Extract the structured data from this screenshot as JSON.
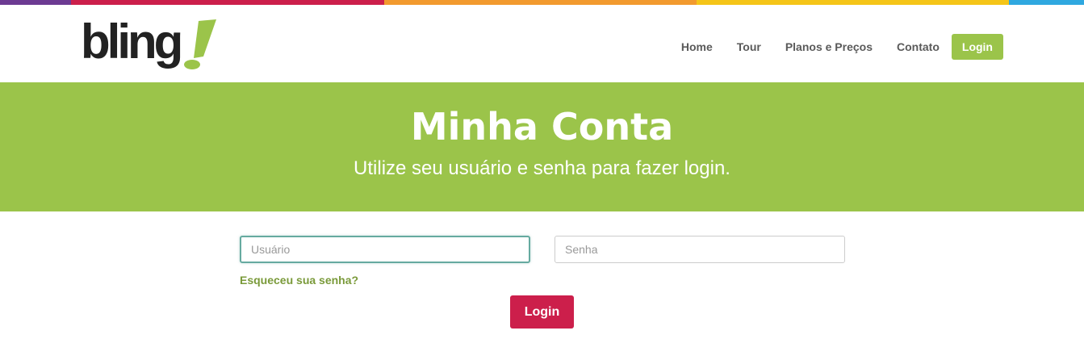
{
  "top_bar": {
    "colors": [
      "#6c3a92",
      "#cc1f4b",
      "#f29a2e",
      "#f5c518",
      "#2fa8e0"
    ]
  },
  "brand": {
    "logo_text": "bling",
    "accent_color": "#9bc44a",
    "login_color": "#cc1f4b"
  },
  "nav": {
    "items": [
      {
        "label": "Home"
      },
      {
        "label": "Tour"
      },
      {
        "label": "Planos e Preços"
      },
      {
        "label": "Contato"
      }
    ],
    "login_label": "Login"
  },
  "hero": {
    "title": "Minha Conta",
    "subtitle": "Utilize seu usuário e senha para fazer login."
  },
  "form": {
    "username_placeholder": "Usuário",
    "username_value": "",
    "password_placeholder": "Senha",
    "password_value": "",
    "forgot_label": "Esqueceu sua senha?",
    "submit_label": "Login"
  }
}
